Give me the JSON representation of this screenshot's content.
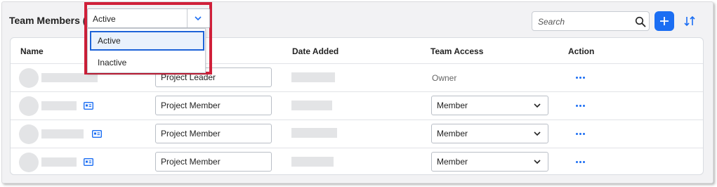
{
  "header": {
    "title": "Team Members (4",
    "search_placeholder": "Search"
  },
  "status_filter": {
    "selected": "Active",
    "options": [
      "Active",
      "Inactive"
    ]
  },
  "table": {
    "columns": [
      "Name",
      "Date Added",
      "Team Access",
      "Action"
    ],
    "rows": [
      {
        "role": "Project Leader",
        "access": "Owner"
      },
      {
        "role": "Project Member",
        "access": "Member"
      },
      {
        "role": "Project Member",
        "access": "Member"
      },
      {
        "role": "Project Member",
        "access": "Member"
      }
    ]
  },
  "colors": {
    "accent": "#1b6ef3",
    "highlight": "#d0203a",
    "panel_bg": "#f2f2f4"
  },
  "icons": [
    "search-icon",
    "plus-icon",
    "sort-icon",
    "chevron-down-icon",
    "contact-card-icon",
    "more-options-icon"
  ]
}
